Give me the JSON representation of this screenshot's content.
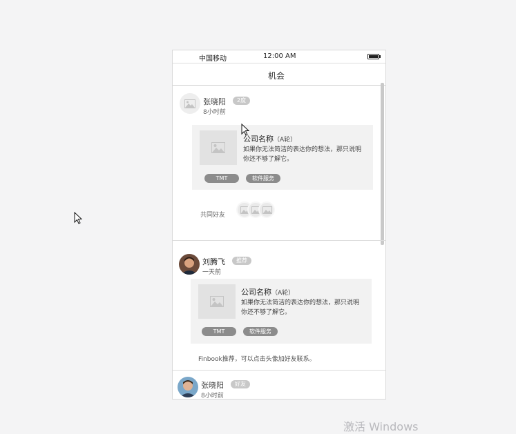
{
  "status_bar": {
    "carrier": "中国移动",
    "time": "12:00 AM"
  },
  "nav": {
    "title": "机会"
  },
  "feed": [
    {
      "name": "张晓阳",
      "badge": "2度",
      "time": "8小时前",
      "avatar": "placeholder-image-icon",
      "card": {
        "company": "公司名称",
        "round": "（A轮）",
        "description": "如果你无法简洁的表达你的想法，那只说明你还不够了解它。",
        "tags": [
          "TMT",
          "软件服务"
        ]
      },
      "mutual_friends_label": "共同好友"
    },
    {
      "name": "刘腾飞",
      "badge": "推荐",
      "time": "一天前",
      "avatar": "user-photo",
      "card": {
        "company": "公司名称",
        "round": "（A轮）",
        "description": "如果你无法简洁的表达你的想法，那只说明你还不够了解它。",
        "tags": [
          "TMT",
          "软件服务"
        ]
      },
      "recommendation": "Finbook推荐，可以点击头像加好友联系。"
    },
    {
      "name": "张晓阳",
      "badge": "好友",
      "time": "8小时前",
      "avatar": "user-photo"
    }
  ],
  "watermark": "激活 Windows",
  "colors": {
    "badge": "#c8c8c8",
    "tag": "#8c8c8c",
    "card_bg": "#f2f2f2",
    "page_bg": "#f4f4f5"
  }
}
